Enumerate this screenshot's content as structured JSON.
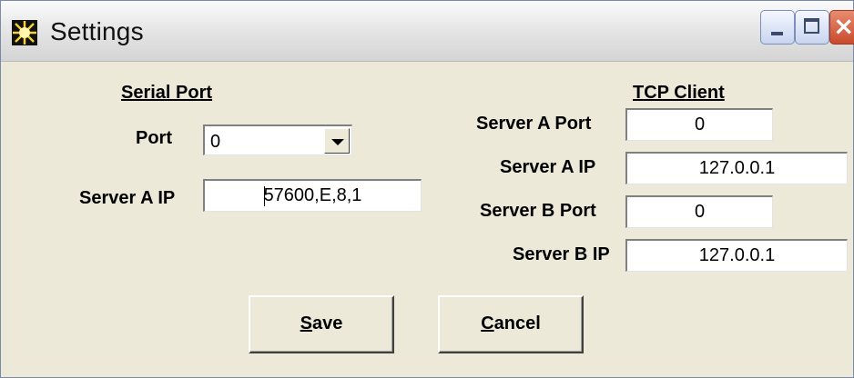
{
  "window": {
    "title": "Settings"
  },
  "serial": {
    "heading": "Serial Port",
    "port_label": "Port",
    "port_value": "0",
    "ip_label": "Server A IP",
    "ip_value": "57600,E,8,1"
  },
  "tcp": {
    "heading": "TCP Client",
    "a_port_label": "Server A Port",
    "a_port_value": "0",
    "a_ip_label": "Server A IP",
    "a_ip_value": "127.0.0.1",
    "b_port_label": "Server B Port",
    "b_port_value": "0",
    "b_ip_label": "Server B IP",
    "b_ip_value": "127.0.0.1"
  },
  "buttons": {
    "save_mnemonic": "S",
    "save_rest": "ave",
    "cancel_mnemonic": "C",
    "cancel_rest": "ancel"
  },
  "icons": {
    "app": "sun-icon",
    "minimize": "minimize-icon",
    "maximize": "maximize-icon",
    "close": "close-icon",
    "dropdown": "chevron-down-icon"
  },
  "colors": {
    "dialog_bg": "#ece9d8",
    "close_button": "#c94b2c"
  }
}
